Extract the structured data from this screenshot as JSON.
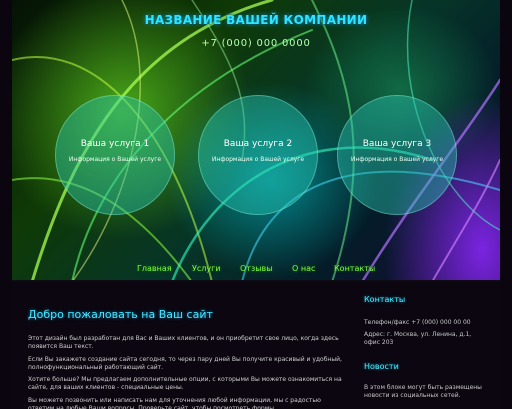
{
  "header": {
    "company_name": "НАЗВАНИЕ ВАШЕЙ КОМПАНИИ",
    "phone": "+7 (000) 000 0000"
  },
  "services": [
    {
      "title": "Ваша услуга 1",
      "text": "Информация о Вашей услуге"
    },
    {
      "title": "Ваша услуга 2",
      "text": "Информация о Вашей услуге"
    },
    {
      "title": "Ваша услуга 3",
      "text": "Информация о Вашей услуге"
    }
  ],
  "nav": {
    "items": [
      "Главная",
      "Услуги",
      "Отзывы",
      "О нас",
      "Контакты"
    ]
  },
  "main": {
    "welcome_title": "Добро пожаловать на Ваш сайт",
    "paragraphs": [
      "Этот дизайн был разработан для Вас и Ваших клиентов, и он приобретит свое лицо, когда здесь появится Ваш текст.",
      "Если Вы закажете создание сайта сегодня, то через пару дней Вы получите красивый и удобный, полнофункциональный работающий сайт.",
      "Хотите больше? Мы предлагаем дополнительные опции, с которыми Вы можете ознакомиться на сайте, для ваших клиентов - специальные цены.",
      "Вы можете позвонить или написать нам для уточнения любой информации, мы с радостью ответим на любые Ваши вопросы. Проверьте сайт, чтобы посмотреть формы."
    ]
  },
  "sidebar": {
    "contacts_title": "Контакты",
    "phone_fax": "Телефон/факс +7 (000) 000 00 00",
    "address": "Адрес: г. Москва, ул. Ленина, д.1, офис 203",
    "news_title": "Новости",
    "news_text": "В этом блоке могут быть размещены новости из социальных сетей."
  },
  "colors": {
    "accent_cyan": "#30e6ff",
    "nav_green": "#78ff40",
    "circle_fill": "#28c8b4"
  }
}
